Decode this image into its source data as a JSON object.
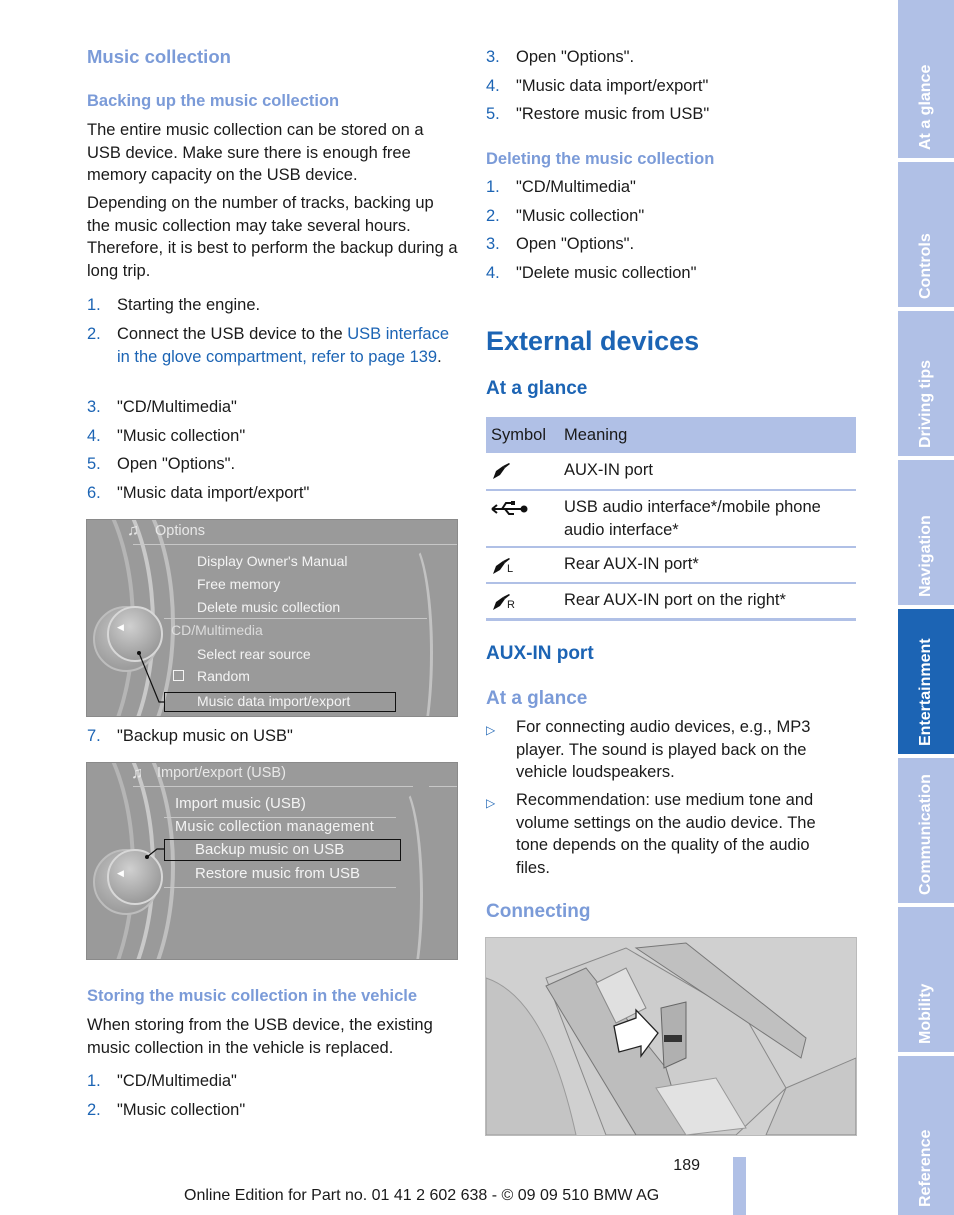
{
  "left_column": {
    "section_title": "Music collection",
    "backup": {
      "heading": "Backing up the music collection",
      "para1": "The entire music collection can be stored on a USB device. Make sure there is enough free memory capacity on the USB device.",
      "para2": "Depending on the number of tracks, backing up the music collection may take several hours. Therefore, it is best to perform the backup during a long trip.",
      "steps": [
        {
          "num": "1.",
          "text": "Starting the engine."
        },
        {
          "num": "2.",
          "text_before": "Connect the USB device to the ",
          "link": "USB interface in the glove compartment, refer to page 139",
          "text_after": "."
        },
        {
          "num": "3.",
          "text": "\"CD/Multimedia\""
        },
        {
          "num": "4.",
          "text": "\"Music collection\""
        },
        {
          "num": "5.",
          "text": "Open \"Options\"."
        },
        {
          "num": "6.",
          "text": "\"Music data import/export\""
        }
      ],
      "step7": {
        "num": "7.",
        "text": "\"Backup music on USB\""
      }
    },
    "screen_options": {
      "title": "Options",
      "items": [
        "Display Owner's Manual",
        "Free memory",
        "Delete music collection"
      ],
      "group": "CD/Multimedia",
      "group_items": [
        "Select rear source",
        "Random",
        "Music data import/export"
      ],
      "random_checked": false
    },
    "screen_import": {
      "title": "Import/export (USB)",
      "items": [
        "Import music (USB)",
        "Music collection management"
      ],
      "sub_items": [
        "Backup music on USB",
        "Restore music from USB"
      ]
    },
    "storing": {
      "heading": "Storing the music collection in the vehicle",
      "para": "When storing from the USB device, the existing music collection in the vehicle is replaced.",
      "steps": [
        {
          "num": "1.",
          "text": "\"CD/Multimedia\""
        },
        {
          "num": "2.",
          "text": "\"Music collection\""
        }
      ]
    }
  },
  "right_column": {
    "restore_steps": [
      {
        "num": "3.",
        "text": "Open \"Options\"."
      },
      {
        "num": "4.",
        "text": "\"Music data import/export\""
      },
      {
        "num": "5.",
        "text": "\"Restore music from USB\""
      }
    ],
    "deleting": {
      "heading": "Deleting the music collection",
      "steps": [
        {
          "num": "1.",
          "text": "\"CD/Multimedia\""
        },
        {
          "num": "2.",
          "text": "\"Music collection\""
        },
        {
          "num": "3.",
          "text": "Open \"Options\"."
        },
        {
          "num": "4.",
          "text": "\"Delete music collection\""
        }
      ]
    },
    "external_devices": {
      "title": "External devices",
      "at_a_glance": "At a glance",
      "table": {
        "headers": [
          "Symbol",
          "Meaning"
        ],
        "rows": [
          {
            "icon": "aux-plug-icon",
            "glyph": "✐",
            "sub": "",
            "meaning": "AUX-IN port"
          },
          {
            "icon": "usb-icon",
            "glyph": "⭠⊸",
            "sub": "",
            "meaning": "USB audio interface*/mobile phone audio interface*"
          },
          {
            "icon": "aux-plug-left-icon",
            "glyph": "✐",
            "sub": "L",
            "meaning": "Rear AUX-IN port*"
          },
          {
            "icon": "aux-plug-right-icon",
            "glyph": "✐",
            "sub": "R",
            "meaning": "Rear AUX-IN port on the right*"
          }
        ]
      }
    },
    "aux_in": {
      "title": "AUX-IN port",
      "at_a_glance": "At a glance",
      "bullet_glyph": "▷",
      "bullets": [
        "For connecting audio devices, e.g., MP3 player. The sound is played back on the vehicle loudspeakers.",
        "Recommendation: use medium tone and volume settings on the audio device. The tone depends on the quality of the audio files."
      ],
      "connecting": "Connecting"
    }
  },
  "side_tabs": [
    {
      "label": "At a glance",
      "active": false
    },
    {
      "label": "Controls",
      "active": false
    },
    {
      "label": "Driving tips",
      "active": false
    },
    {
      "label": "Navigation",
      "active": false
    },
    {
      "label": "Entertainment",
      "active": true
    },
    {
      "label": "Communication",
      "active": false
    },
    {
      "label": "Mobility",
      "active": false
    },
    {
      "label": "Reference",
      "active": false
    }
  ],
  "footer": {
    "page_number": "189",
    "edition": "Online Edition for Part no. 01 41 2 602 638 - © 09 09 510 BMW AG"
  },
  "colors": {
    "heading_dark": "#1c64b4",
    "heading_light": "#7b9bd8",
    "tab_bg": "#b0c0e6",
    "tab_active": "#1c64b4"
  }
}
